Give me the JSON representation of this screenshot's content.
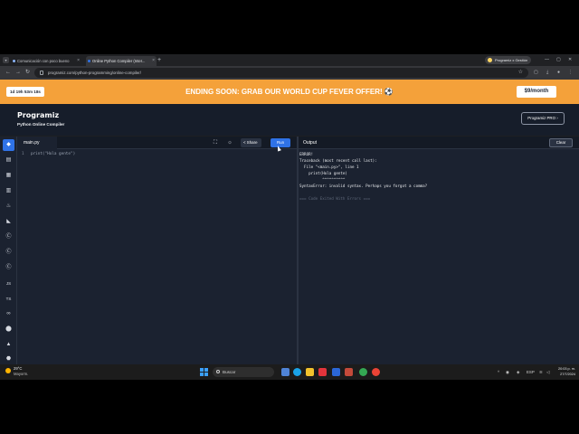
{
  "browser": {
    "tabs": [
      {
        "label": "Comunicación con poco bueno",
        "active": false
      },
      {
        "label": "Online Python Compiler (Inter...",
        "active": true
      }
    ],
    "new_tab": "+",
    "profile": "Programiz x Gestión",
    "url": "programiz.com/python-programming/online-compiler/",
    "tab_menu_icon": "chevron-down-icon",
    "window_controls": [
      "—",
      "▢",
      "✕"
    ]
  },
  "promo": {
    "timer": "1d 19h 53m 18s",
    "text": "ENDING SOON: GRAB OUR WORLD CUP FEVER OFFER! ⚽",
    "price": "$9/month",
    "accent": "#f4a13a"
  },
  "header": {
    "logo": "Programiz",
    "subtitle": "Python Online Compiler",
    "pro_button": "Programiz PRO ›"
  },
  "sidebar": {
    "icons": [
      "python-icon",
      "sql-icon",
      "html-icon",
      "db-icon",
      "java-icon",
      "kotlin-icon",
      "c-icon",
      "cpp-icon",
      "csharp-icon",
      "js-icon",
      "ts-icon",
      "go-icon",
      "php-icon",
      "swift-icon",
      "rust-icon"
    ],
    "glyphs": [
      "◆",
      "▤",
      "▦",
      "▥",
      "♨",
      "◣",
      "Ⓒ",
      "Ⓒ",
      "Ⓒ",
      "JS",
      "TS",
      "∞",
      "⬤",
      "▲",
      "⬣"
    ],
    "active_index": 0
  },
  "editor": {
    "file_name": "main.py",
    "share_label": "Share",
    "run_label": "Run",
    "lines": [
      {
        "no": "1",
        "code": "print(\"Hola gente\")"
      }
    ]
  },
  "output": {
    "title": "Output",
    "clear_label": "Clear",
    "lines": [
      {
        "text": "ERROR!",
        "dim": false
      },
      {
        "text": "Traceback (most recent call last):",
        "dim": false
      },
      {
        "text": "  File \"<main.py>\", line 1",
        "dim": false
      },
      {
        "text": "    print(Hola gente)",
        "dim": false
      },
      {
        "text": "          ^^^^^^^^^^",
        "dim": false
      },
      {
        "text": "SyntaxError: invalid syntax. Perhaps you forgot a comma?",
        "dim": false
      },
      {
        "text": "",
        "dim": false
      },
      {
        "text": "=== Code Exited With Errors ===",
        "dim": true
      }
    ]
  },
  "taskbar": {
    "weather_temp": "29°C",
    "weather_desc": "Mayorm.",
    "search_placeholder": "Buscar",
    "tray_lang": "ESP",
    "time": "20:03 p. m.",
    "date": "27/7/2024"
  }
}
